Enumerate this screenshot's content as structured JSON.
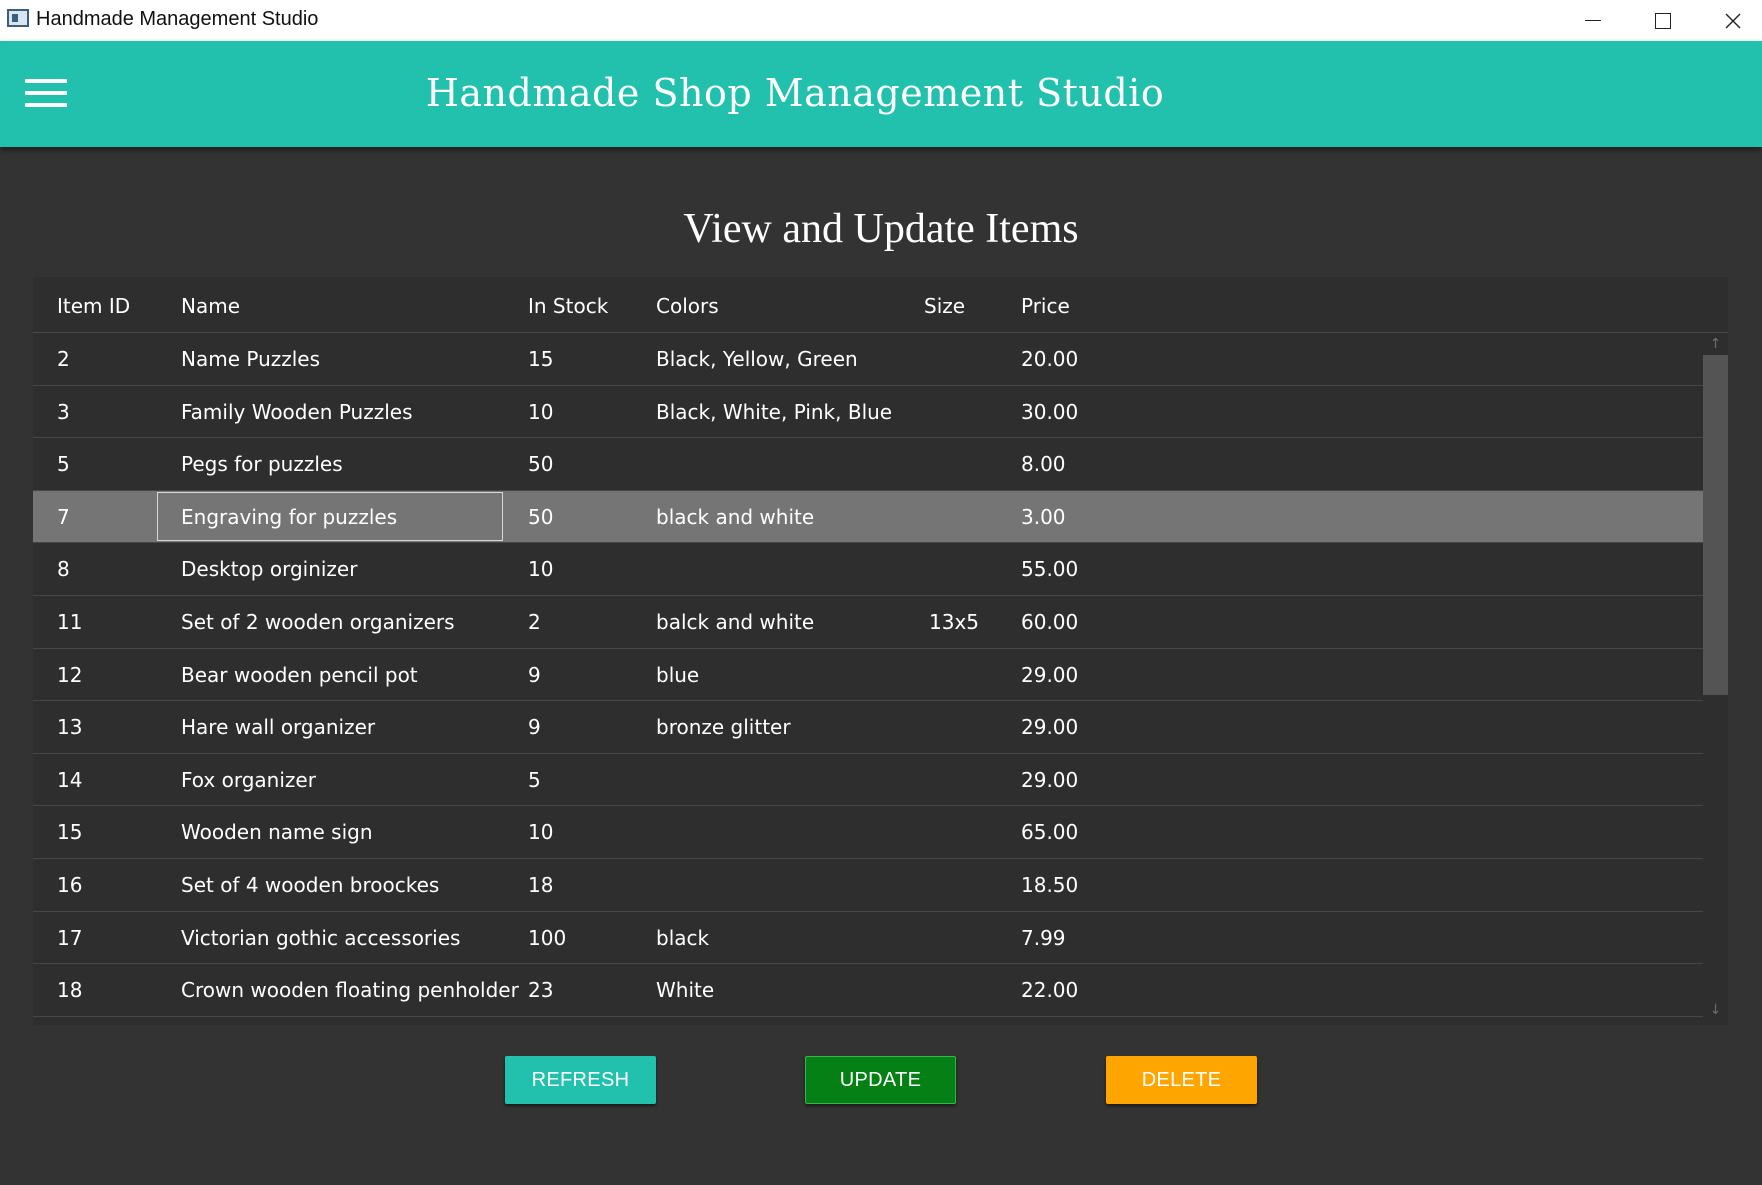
{
  "window": {
    "title": "Handmade Management Studio",
    "controls": {
      "minimize": "—",
      "maximize": "☐",
      "close": "✕"
    }
  },
  "header": {
    "title": "Handmade Shop Management Studio",
    "menu_icon": "hamburger-icon",
    "accent_color": "#22c1ae"
  },
  "page": {
    "title": "View and Update Items"
  },
  "table": {
    "columns": [
      "Item ID",
      "Name",
      "In Stock",
      "Colors",
      "Size",
      "Price"
    ],
    "selected_row_index": 3,
    "rows": [
      {
        "id": "2",
        "name": "Name Puzzles",
        "stock": "15",
        "colors": " Black, Yellow, Green",
        "size": "",
        "price": "20.00"
      },
      {
        "id": "3",
        "name": "Family Wooden Puzzles",
        "stock": "10",
        "colors": " Black, White, Pink, Blue",
        "size": "",
        "price": "30.00"
      },
      {
        "id": "5",
        "name": "Pegs for puzzles",
        "stock": "50",
        "colors": "",
        "size": "",
        "price": "8.00"
      },
      {
        "id": "7",
        "name": "Engraving for puzzles",
        "stock": "50",
        "colors": " black and white",
        "size": "",
        "price": "3.00"
      },
      {
        "id": "8",
        "name": "Desktop orginizer",
        "stock": "10",
        "colors": "",
        "size": "",
        "price": "55.00"
      },
      {
        "id": "11",
        "name": "Set of 2 wooden organizers",
        "stock": "2",
        "colors": "balck and white",
        "size": "13x5",
        "price": "60.00"
      },
      {
        "id": "12",
        "name": "Bear wooden pencil pot",
        "stock": "9",
        "colors": "blue",
        "size": "",
        "price": "29.00"
      },
      {
        "id": "13",
        "name": "Hare wall organizer",
        "stock": "9",
        "colors": "bronze glitter",
        "size": "",
        "price": "29.00"
      },
      {
        "id": "14",
        "name": "Fox organizer",
        "stock": "5",
        "colors": "",
        "size": "",
        "price": "29.00"
      },
      {
        "id": "15",
        "name": "Wooden name sign",
        "stock": "10",
        "colors": "",
        "size": "",
        "price": "65.00"
      },
      {
        "id": "16",
        "name": "Set of 4 wooden broockes",
        "stock": "18",
        "colors": "",
        "size": "",
        "price": "18.50"
      },
      {
        "id": "17",
        "name": "Victorian gothic accessories",
        "stock": "100",
        "colors": "black",
        "size": "",
        "price": "7.99"
      },
      {
        "id": "18",
        "name": "Crown wooden floating penholder",
        "stock": "23",
        "colors": "White",
        "size": "",
        "price": "22.00"
      }
    ]
  },
  "scrollbar": {
    "up_icon": "arrow-up-icon",
    "down_icon": "arrow-down-icon"
  },
  "buttons": {
    "refresh": {
      "label": "REFRESH",
      "color": "#22c1ae"
    },
    "update": {
      "label": "UPDATE",
      "color": "#058014"
    },
    "delete": {
      "label": "DELETE",
      "color": "#ffa500"
    }
  }
}
